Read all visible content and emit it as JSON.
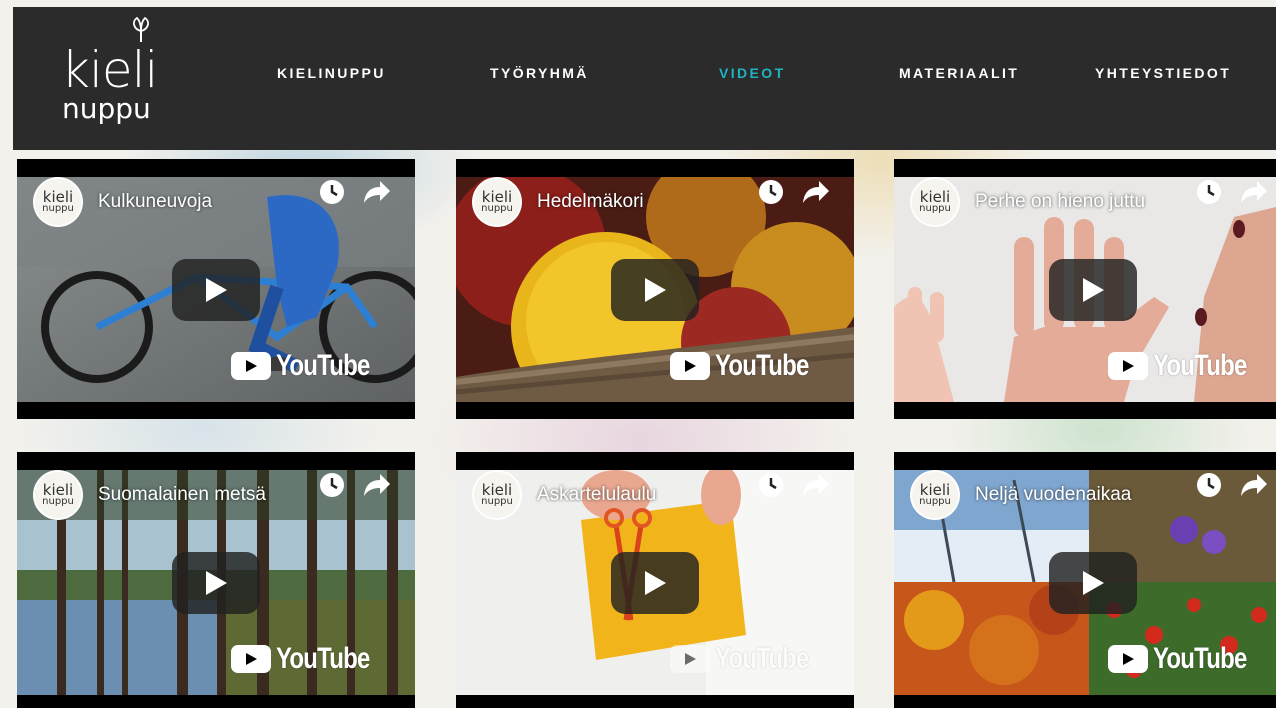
{
  "logo": {
    "line1": "kieli",
    "line2": "nuppu",
    "icon": "bud-leaf-icon"
  },
  "nav": [
    {
      "label": "KIELINUPPU",
      "active": false
    },
    {
      "label": "TYÖRYHMÄ",
      "active": false
    },
    {
      "label": "VIDEOT",
      "active": true
    },
    {
      "label": "MATERIAALIT",
      "active": false
    },
    {
      "label": "YHTEYSTIEDOT",
      "active": false
    }
  ],
  "colors": {
    "header_bg": "#2b2b2b",
    "nav_active": "#1fb2bf",
    "nav_text": "#ffffff"
  },
  "videos": [
    {
      "title": "Kulkuneuvoja",
      "channel": {
        "line1": "kieli",
        "line2": "nuppu"
      },
      "watermark": "YouTube",
      "icons": [
        "clock-icon",
        "share-icon",
        "play-icon"
      ]
    },
    {
      "title": "Hedelmäkori",
      "channel": {
        "line1": "kieli",
        "line2": "nuppu"
      },
      "watermark": "YouTube",
      "icons": [
        "clock-icon",
        "share-icon",
        "play-icon"
      ]
    },
    {
      "title": "Perhe on hieno juttu",
      "channel": {
        "line1": "kieli",
        "line2": "nuppu"
      },
      "watermark": "YouTube",
      "icons": [
        "clock-icon",
        "share-icon",
        "play-icon"
      ]
    },
    {
      "title": "Suomalainen metsä",
      "channel": {
        "line1": "kieli",
        "line2": "nuppu"
      },
      "watermark": "YouTube",
      "icons": [
        "clock-icon",
        "share-icon",
        "play-icon"
      ]
    },
    {
      "title": "Askartelulaulu",
      "channel": {
        "line1": "kieli",
        "line2": "nuppu"
      },
      "watermark": "YouTube",
      "icons": [
        "clock-icon",
        "share-icon",
        "play-icon"
      ]
    },
    {
      "title": "Neljä vuodenaikaa",
      "channel": {
        "line1": "kieli",
        "line2": "nuppu"
      },
      "watermark": "YouTube",
      "icons": [
        "clock-icon",
        "share-icon",
        "play-icon"
      ]
    }
  ]
}
